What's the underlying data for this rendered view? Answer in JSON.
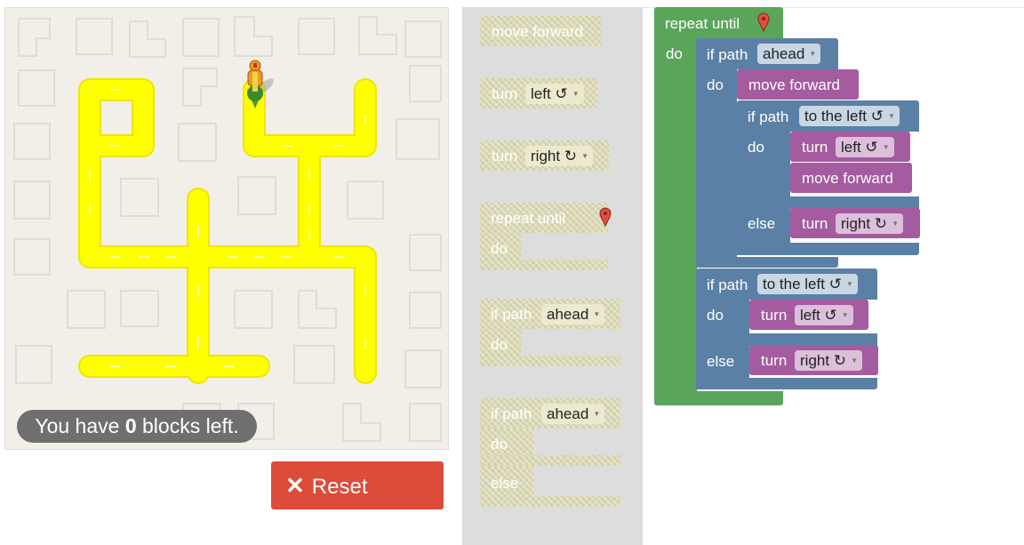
{
  "status": {
    "prefix": "You have ",
    "count": "0",
    "suffix": " blocks left."
  },
  "reset": {
    "icon": "close-x-icon",
    "label": "Reset"
  },
  "colors": {
    "reset": "#dd4b39",
    "path": "#ffff00",
    "loop_green": "#5ba55b",
    "logic_blue": "#5b80a5",
    "action_purple": "#a55b9f"
  },
  "toolbox": {
    "move_forward": "move forward",
    "turn_left": {
      "label": "turn",
      "value": "left ↺"
    },
    "turn_right": {
      "label": "turn",
      "value": "right ↻"
    },
    "repeat_until": {
      "label": "repeat until",
      "do": "do"
    },
    "if_path": {
      "label": "if path",
      "value": "ahead",
      "do": "do"
    },
    "if_else_path": {
      "label": "if path",
      "value": "ahead",
      "do": "do",
      "else": "else"
    }
  },
  "workspace": {
    "repeat_until": "repeat until",
    "repeat_do": "do",
    "if1": {
      "label": "if path",
      "value": "ahead",
      "do": "do"
    },
    "move1": "move forward",
    "if2": {
      "label": "if path",
      "value": "to the left ↺",
      "do": "do",
      "else": "else"
    },
    "turn_left_1": {
      "label": "turn",
      "value": "left ↺"
    },
    "move2": "move forward",
    "turn_right_1": {
      "label": "turn",
      "value": "right ↻"
    },
    "if3": {
      "label": "if path",
      "value": "to the left ↺",
      "do": "do",
      "else": "else"
    },
    "turn_left_2": {
      "label": "turn",
      "value": "left ↺"
    },
    "turn_right_2": {
      "label": "turn",
      "value": "right ↻"
    }
  }
}
